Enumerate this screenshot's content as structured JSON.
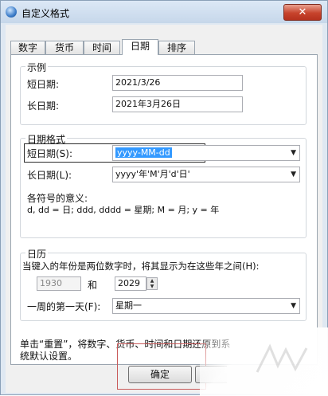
{
  "window": {
    "title": "自定义格式",
    "close_label": "✕"
  },
  "tabs": [
    {
      "label": "数字"
    },
    {
      "label": "货币"
    },
    {
      "label": "时间"
    },
    {
      "label": "日期",
      "active": true
    },
    {
      "label": "排序"
    }
  ],
  "example": {
    "group_label": "示例",
    "short_label": "短日期:",
    "short_value": "2021/3/26",
    "long_label": "长日期:",
    "long_value": "2021年3月26日"
  },
  "date_format": {
    "group_label": "日期格式",
    "short_label": "短日期(S):",
    "short_value": "yyyy-MM-dd",
    "long_label": "长日期(L):",
    "long_value": "yyyy'年'M'月'd'日'",
    "meaning_title": "各符号的意义:",
    "meaning_text": "d, dd = 日;  ddd, dddd = 星期;  M = 月;  y = 年"
  },
  "calendar": {
    "group_label": "日历",
    "two_digit_text": "当键入的年份是两位数字时，将其显示为在这些年之间(H):",
    "year_from": "1930",
    "and_label": "和",
    "year_to": "2029",
    "first_day_label": "一周的第一天(F):",
    "first_day_value": "星期一"
  },
  "footer": {
    "reset_text_line1": "单击“重置”，将数字、货币、时间和日期还原到系",
    "reset_text_line2": "统默认设置。",
    "ok_label": "确定"
  },
  "colors": {
    "accent": "#3399ff",
    "highlight_box": "#c95b5b",
    "close": "#c7432c"
  }
}
